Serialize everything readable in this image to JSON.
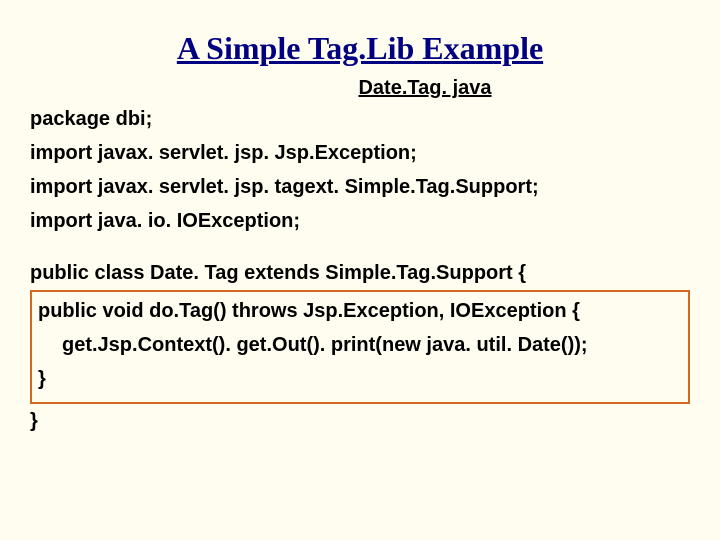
{
  "title": "A Simple Tag.Lib Example",
  "subtitle": "Date.Tag. java",
  "lines": {
    "l1": "package dbi;",
    "l2": "import javax. servlet. jsp. Jsp.Exception;",
    "l3": "import javax. servlet. jsp. tagext. Simple.Tag.Support;",
    "l4": "import java. io. IOException;",
    "l5": "public class Date. Tag extends Simple.Tag.Support {",
    "l6": "public void do.Tag() throws Jsp.Exception, IOException {",
    "l7": "get.Jsp.Context(). get.Out(). print(new java. util. Date());",
    "l8": "}",
    "l9": "}"
  }
}
